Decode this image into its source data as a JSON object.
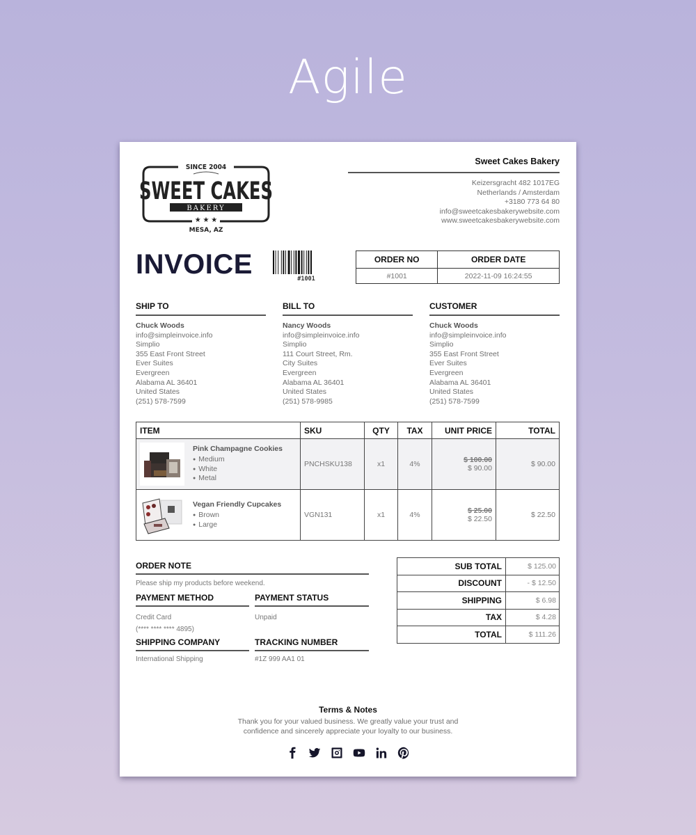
{
  "page": {
    "title": "Agile"
  },
  "company": {
    "logo": {
      "since": "SINCE 2004",
      "name": "SWEET CAKES",
      "subtitle": "BAKERY",
      "location": "MESA, AZ"
    },
    "name": "Sweet Cakes Bakery",
    "address_lines": [
      "Keizersgracht 482 1017EG",
      "Netherlands / Amsterdam",
      "+3180 773 64 80",
      "info@sweetcakesbakerywebsite.com",
      "www.sweetcakesbakerywebsite.com"
    ]
  },
  "invoice": {
    "title": "INVOICE",
    "barcode_text": "#1001",
    "order_no_label": "ORDER NO",
    "order_date_label": "ORDER DATE",
    "order_no": "#1001",
    "order_date": "2022-11-09 16:24:55"
  },
  "parties": {
    "ship_to": {
      "label": "SHIP TO",
      "name": "Chuck Woods",
      "lines": [
        "info@simpleinvoice.info",
        "Simplio",
        "355 East Front Street",
        "Ever Suites",
        "Evergreen",
        "Alabama AL 36401",
        "United States",
        "(251) 578-7599"
      ]
    },
    "bill_to": {
      "label": "BILL TO",
      "name": "Nancy Woods",
      "lines": [
        "info@simpleinvoice.info",
        "Simplio",
        "111 Court Street, Rm.",
        "City Suites",
        "Evergreen",
        "Alabama AL 36401",
        "United States",
        "(251) 578-9985"
      ]
    },
    "customer": {
      "label": "CUSTOMER",
      "name": "Chuck Woods",
      "lines": [
        "info@simpleinvoice.info",
        "Simplio",
        "355 East Front Street",
        "Ever Suites",
        "Evergreen",
        "Alabama AL 36401",
        "United States",
        "(251) 578-7599"
      ]
    }
  },
  "items": {
    "headers": {
      "item": "ITEM",
      "sku": "SKU",
      "qty": "QTY",
      "tax": "TAX",
      "unit_price": "UNIT PRICE",
      "total": "TOTAL"
    },
    "rows": [
      {
        "name": "Pink Champagne Cookies",
        "options": [
          "Medium",
          "White",
          "Metal"
        ],
        "sku": "PNCHSKU138",
        "qty": "x1",
        "tax": "4%",
        "original_price": "$ 100.00",
        "unit_price": "$ 90.00",
        "total": "$ 90.00"
      },
      {
        "name": "Vegan Friendly Cupcakes",
        "options": [
          "Brown",
          "Large"
        ],
        "sku": "VGN131",
        "qty": "x1",
        "tax": "4%",
        "original_price": "$ 25.00",
        "unit_price": "$ 22.50",
        "total": "$ 22.50"
      }
    ]
  },
  "details": {
    "order_note_label": "ORDER NOTE",
    "order_note": "Please ship my products before weekend.",
    "payment_method_label": "PAYMENT METHOD",
    "payment_method": "Credit Card",
    "payment_card": "(**** **** **** 4895)",
    "payment_status_label": "PAYMENT STATUS",
    "payment_status": "Unpaid",
    "shipping_company_label": "SHIPPING COMPANY",
    "shipping_company": "International Shipping",
    "tracking_number_label": "TRACKING NUMBER",
    "tracking_number": "#1Z 999 AA1 01"
  },
  "summary": [
    {
      "label": "SUB TOTAL",
      "value": "$ 125.00"
    },
    {
      "label": "DISCOUNT",
      "value": "- $ 12.50"
    },
    {
      "label": "SHIPPING",
      "value": "$ 6.98"
    },
    {
      "label": "TAX",
      "value": "$ 4.28"
    },
    {
      "label": "TOTAL",
      "value": "$ 111.26"
    }
  ],
  "footer": {
    "terms_title": "Terms & Notes",
    "terms_lines": [
      "Thank you for your valued business. We greatly value your trust and",
      "confidence and sincerely appreciate your loyalty to our business."
    ],
    "social_icons": [
      "facebook-icon",
      "twitter-icon",
      "instagram-icon",
      "youtube-icon",
      "linkedin-icon",
      "pinterest-icon"
    ]
  }
}
